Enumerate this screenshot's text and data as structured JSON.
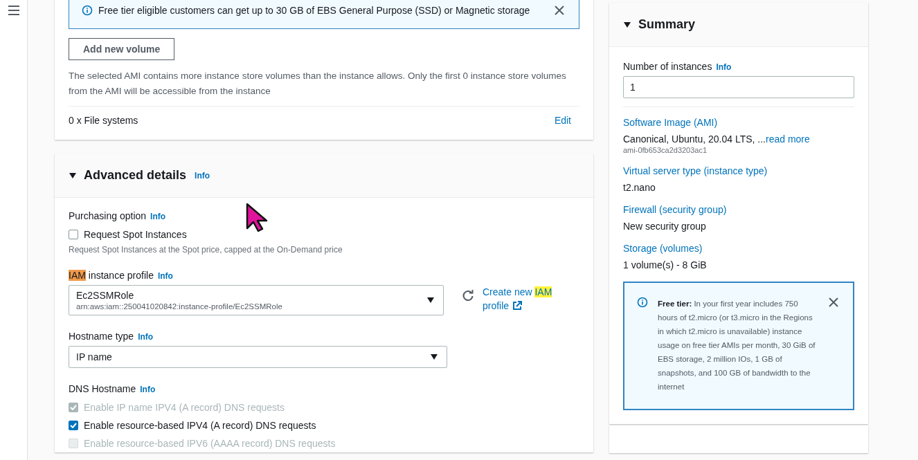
{
  "storage_card": {
    "free_tier_alert": {
      "text": "Free tier eligible customers can get up to 30 GB of EBS General Purpose (SSD) or Magnetic storage"
    },
    "add_volume_button": "Add new volume",
    "warning": "The selected AMI contains more instance store volumes than the instance allows. Only the first 0 instance store volumes from the AMI will be accessible from the instance",
    "file_systems": {
      "label": "0 x File systems",
      "action": "Edit"
    }
  },
  "advanced_details": {
    "title": "Advanced details",
    "info": "Info",
    "expanded": true,
    "purchasing_option": {
      "label": "Purchasing option",
      "info": "Info",
      "checkbox": {
        "label": "Request Spot Instances",
        "checked": false,
        "disabled": false
      },
      "hint": "Request Spot Instances at the Spot price, capped at the On-Demand price"
    },
    "iam_profile": {
      "label_parts": [
        {
          "text": "IAM",
          "highlighted": true,
          "selected": true
        },
        {
          "text": " instance profile",
          "highlighted": false,
          "selected": false
        }
      ],
      "info": "Info",
      "value": "Ec2SSMRole",
      "detail": "arn:aws:iam::250041020842:instance-profile/Ec2SSMRole",
      "create_link_parts": [
        {
          "text": "Create new ",
          "highlighted": false,
          "selected": false
        },
        {
          "text": "IAM",
          "highlighted": true,
          "selected": false
        },
        {
          "text": " profile",
          "highlighted": false,
          "selected": false
        }
      ]
    },
    "hostname_type": {
      "label": "Hostname type",
      "info": "Info",
      "value": "IP name"
    },
    "dns_hostname": {
      "label": "DNS Hostname",
      "info": "Info",
      "options": [
        {
          "label": "Enable IP name IPV4 (A record) DNS requests",
          "checked": true,
          "disabled": true
        },
        {
          "label": "Enable resource-based IPV4 (A record) DNS requests",
          "checked": true,
          "disabled": false
        },
        {
          "label": "Enable resource-based IPV6 (AAAA record) DNS requests",
          "checked": false,
          "disabled": true
        }
      ]
    }
  },
  "summary": {
    "title": "Summary",
    "expanded": true,
    "instances": {
      "label": "Number of instances",
      "info": "Info",
      "value": "1"
    },
    "items": [
      {
        "heading": "Software Image (AMI)",
        "value": "Canonical, Ubuntu, 20.04 LTS, ...",
        "link": "read more",
        "detail": "ami-0fb653ca2d3203ac1"
      },
      {
        "heading": "Virtual server type (instance type)",
        "value": "t2.nano"
      },
      {
        "heading": "Firewall (security group)",
        "value": "New security group"
      },
      {
        "heading": "Storage (volumes)",
        "value": "1 volume(s) - 8 GiB"
      }
    ],
    "free_tier": {
      "lead": "Free tier:",
      "text": "In your first year includes 750 hours of t2.micro (or t3.micro in the Regions in which t2.micro is unavailable) instance usage on free tier AMIs per month, 30 GiB of EBS storage, 2 million IOs, 1 GB of snapshots, and 100 GB of bandwidth to the internet"
    }
  }
}
